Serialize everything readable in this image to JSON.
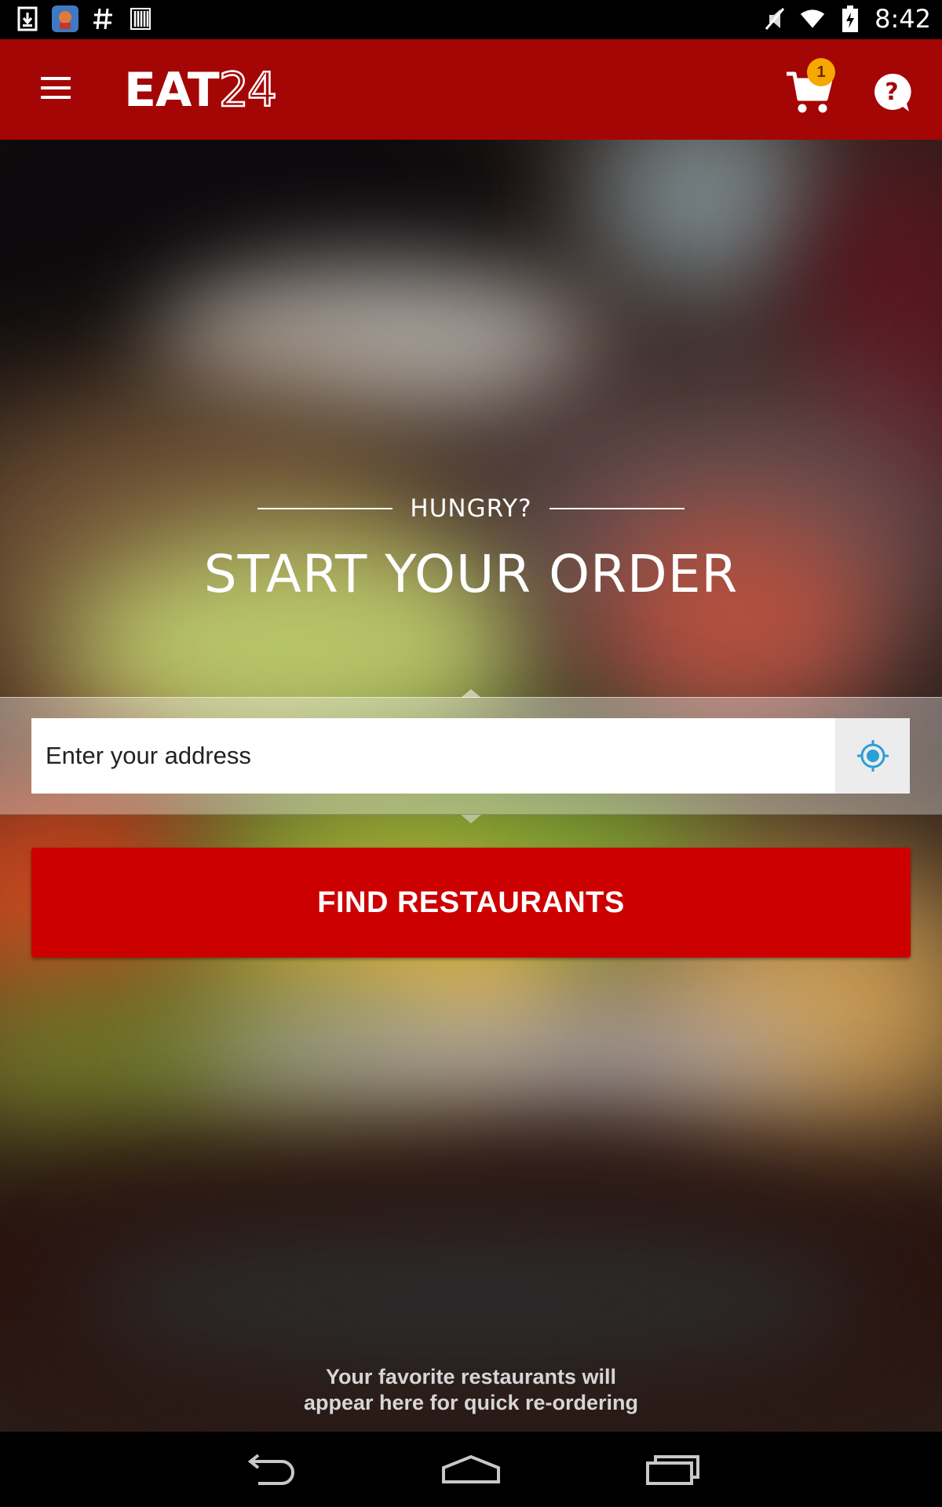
{
  "status_bar": {
    "time": "8:42",
    "left_icons": [
      "download-icon",
      "game-app-icon",
      "hashtag-icon",
      "barcode-icon"
    ],
    "right_icons": [
      "mute-icon",
      "wifi-icon",
      "battery-charging-icon"
    ]
  },
  "app_bar": {
    "logo_bold": "EAT",
    "logo_outline": "24",
    "cart_count": "1",
    "help_glyph": "?",
    "colors": {
      "bar": "#a40606",
      "badge": "#f6a800"
    }
  },
  "hero": {
    "kicker": "HUNGRY?",
    "title": "START YOUR ORDER"
  },
  "search": {
    "placeholder": "Enter your address",
    "locate_icon": "crosshair-location-icon"
  },
  "find_button": {
    "label": "FIND RESTAURANTS",
    "color": "#cc0000"
  },
  "favorites_hint": "Your favorite restaurants will\nappear here for quick re-ordering",
  "nav_bar": {
    "buttons": [
      "back-icon",
      "home-icon",
      "recents-icon"
    ]
  }
}
